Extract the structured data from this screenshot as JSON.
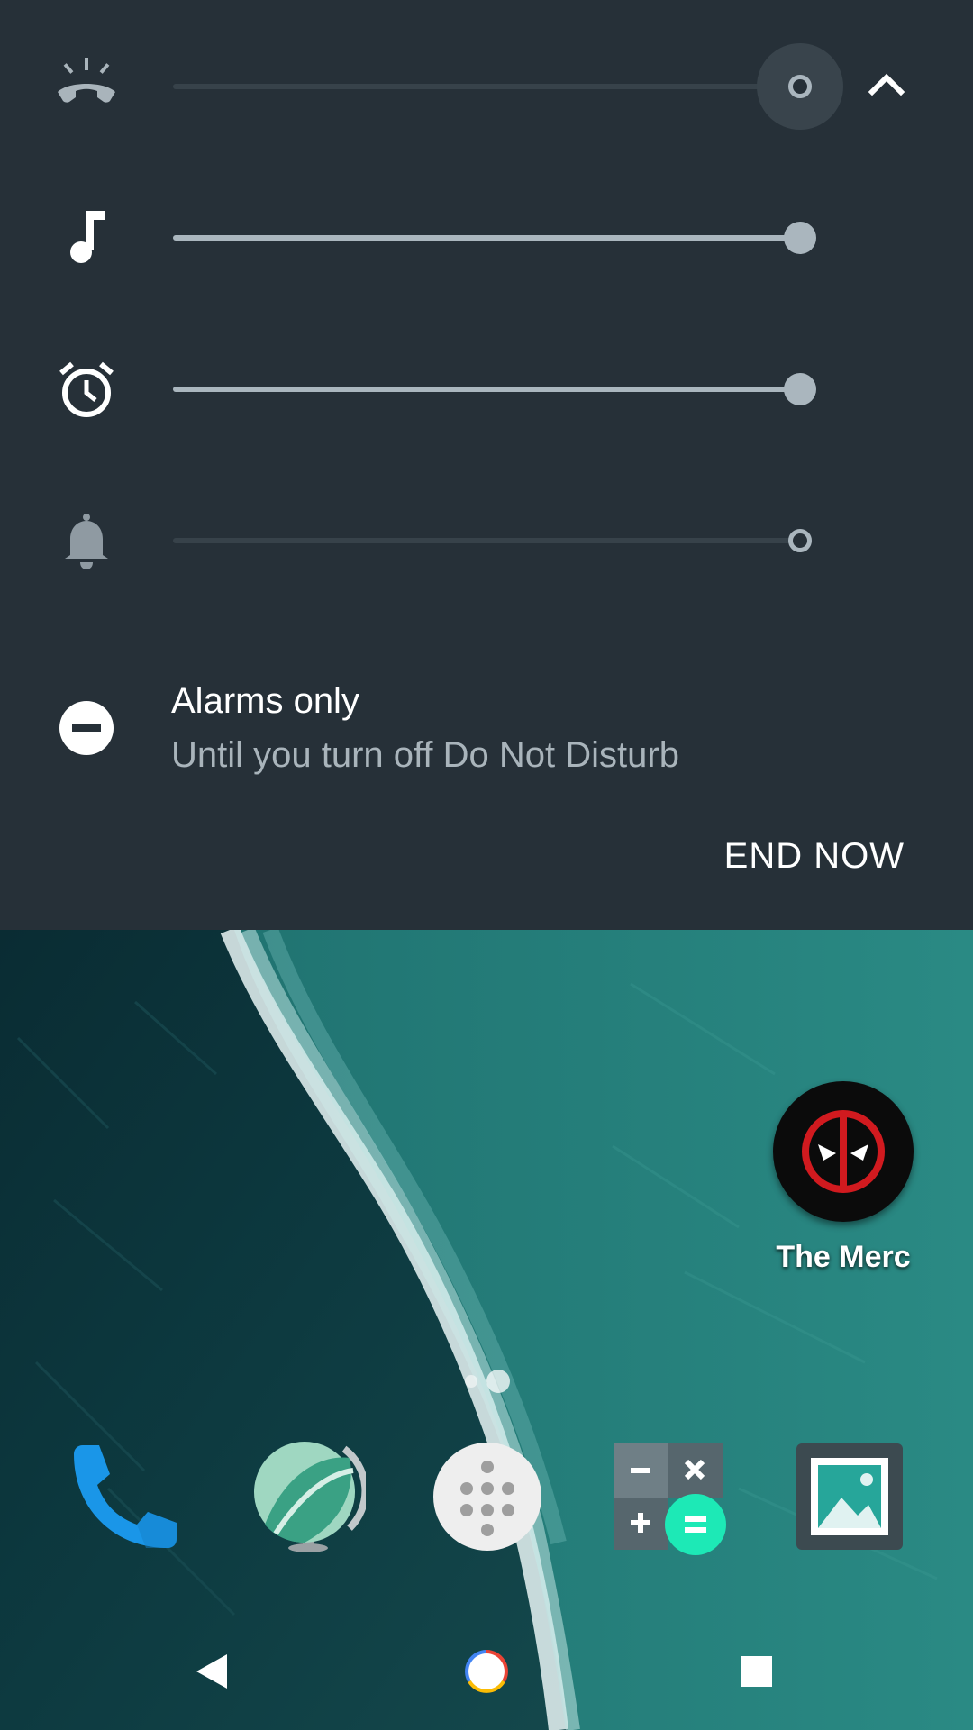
{
  "volume_panel": {
    "rows": [
      {
        "stream": "call",
        "icon": "phone-hangup-icon",
        "level": 0,
        "state": "active"
      },
      {
        "stream": "media",
        "icon": "music-note-icon",
        "level": 1.0
      },
      {
        "stream": "alarm",
        "icon": "alarm-clock-icon",
        "level": 1.0
      },
      {
        "stream": "ring",
        "icon": "bell-icon",
        "level": 0
      }
    ],
    "expand_icon": "chevron-up-icon",
    "dnd": {
      "icon": "do-not-disturb-icon",
      "title": "Alarms only",
      "subtitle": "Until you turn off Do Not Disturb",
      "action_label": "END NOW"
    },
    "colors": {
      "background": "#263038",
      "accent": "#aab6be"
    }
  },
  "home": {
    "shortcut": {
      "label": "The Merc",
      "icon": "deadpool-mask-icon"
    },
    "page_indicator": {
      "pages": 2,
      "current": 2
    },
    "dock": [
      {
        "icon": "phone-icon"
      },
      {
        "icon": "globe-icon"
      },
      {
        "icon": "app-drawer-icon"
      },
      {
        "icon": "calculator-icon"
      },
      {
        "icon": "gallery-icon"
      }
    ]
  },
  "nav_bar": {
    "buttons": [
      {
        "icon": "back-icon"
      },
      {
        "icon": "home-icon"
      },
      {
        "icon": "recents-icon"
      }
    ]
  }
}
